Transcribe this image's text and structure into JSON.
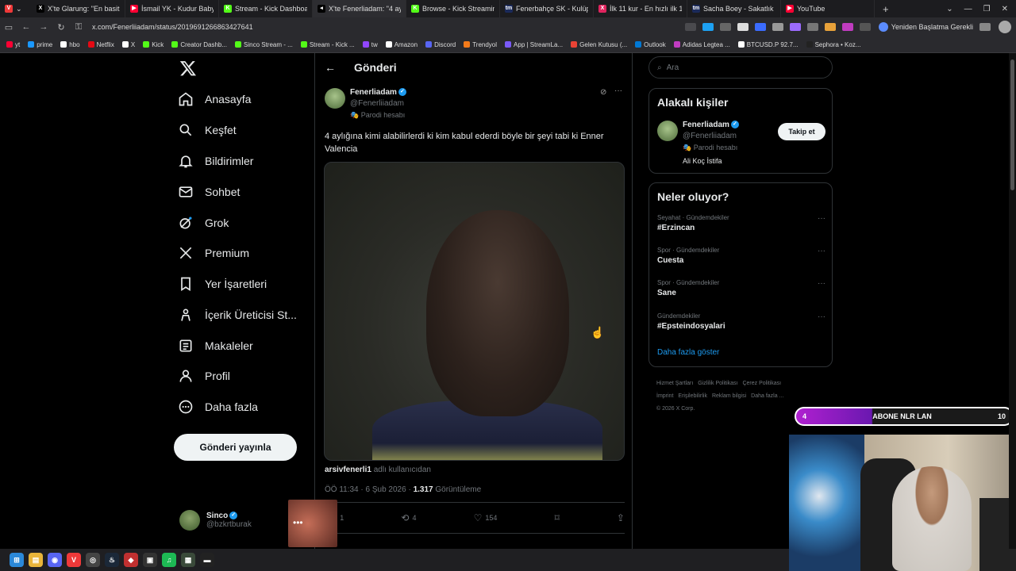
{
  "browser": {
    "tabs": [
      {
        "label": "X'te Glarung: \"En basitinde",
        "fav_color": "#000000",
        "fav_glyph": "X"
      },
      {
        "label": "İsmail YK - Kudur Baby ( Ug",
        "fav_color": "#ff0033",
        "fav_glyph": "▶"
      },
      {
        "label": "Stream - Kick Dashboard",
        "fav_color": "#53fc18",
        "fav_glyph": "K"
      },
      {
        "label": "X'te Fenerliadam: \"4 aylığın",
        "fav_color": "#000000",
        "fav_glyph": "◂"
      },
      {
        "label": "Browse - Kick Streaming",
        "fav_color": "#53fc18",
        "fav_glyph": "K"
      },
      {
        "label": "Fenerbahçe SK - Kulüp pro",
        "fav_color": "#1b2a5a",
        "fav_glyph": "tm"
      },
      {
        "label": "İlk 11 kur - En hızlı ilk 11 ol",
        "fav_color": "#e0245e",
        "fav_glyph": "X"
      },
      {
        "label": "Sacha Boey - Sakatlık geçmi",
        "fav_color": "#1b2a5a",
        "fav_glyph": "tm"
      },
      {
        "label": "YouTube",
        "fav_color": "#ff0033",
        "fav_glyph": "▶"
      }
    ],
    "active_tab": 3,
    "url": "x.com/Fenerliiadam/status/2019691266863427641",
    "restart_label": "Yeniden Başlatma Gerekli",
    "bookmarks": [
      {
        "label": "yt",
        "color": "#ff0033"
      },
      {
        "label": "prime",
        "color": "#1a98ff"
      },
      {
        "label": "hbo",
        "color": "#ffffff"
      },
      {
        "label": "Netflix",
        "color": "#e50914"
      },
      {
        "label": "X",
        "color": "#ffffff"
      },
      {
        "label": "Kick",
        "color": "#53fc18"
      },
      {
        "label": "Creator Dashb...",
        "color": "#53fc18"
      },
      {
        "label": "Sinco Stream - ...",
        "color": "#53fc18"
      },
      {
        "label": "Stream - Kick ...",
        "color": "#53fc18"
      },
      {
        "label": "tw",
        "color": "#9146ff"
      },
      {
        "label": "Amazon",
        "color": "#ffffff"
      },
      {
        "label": "Discord",
        "color": "#5865f2"
      },
      {
        "label": "Trendyol",
        "color": "#f27a1a"
      },
      {
        "label": "App | StreamLa...",
        "color": "#7a5af8"
      },
      {
        "label": "Gelen Kutusu (...",
        "color": "#ea4335"
      },
      {
        "label": "Outlook",
        "color": "#0078d4"
      },
      {
        "label": "Adidas Legtea ...",
        "color": "#c03cc0"
      },
      {
        "label": "BTCUSD.P 92.7...",
        "color": "#ffffff"
      },
      {
        "label": "Sephora • Koz...",
        "color": "#222222"
      }
    ]
  },
  "nav": {
    "items": [
      {
        "label": "Anasayfa",
        "icon": "home-icon"
      },
      {
        "label": "Keşfet",
        "icon": "search-icon"
      },
      {
        "label": "Bildirimler",
        "icon": "bell-icon"
      },
      {
        "label": "Sohbet",
        "icon": "mail-icon"
      },
      {
        "label": "Grok",
        "icon": "grok-icon"
      },
      {
        "label": "Premium",
        "icon": "x-icon"
      },
      {
        "label": "Yer İşaretleri",
        "icon": "bookmark-icon"
      },
      {
        "label": "İçerik Üreticisi St...",
        "icon": "creator-icon"
      },
      {
        "label": "Makaleler",
        "icon": "article-icon"
      },
      {
        "label": "Profil",
        "icon": "person-icon"
      },
      {
        "label": "Daha fazla",
        "icon": "more-circle-icon"
      }
    ],
    "post_button": "Gönderi yayınla",
    "account": {
      "name": "Sinco",
      "handle": "@bzkrtburak"
    }
  },
  "post": {
    "header_title": "Gönderi",
    "author_name": "Fenerliadam",
    "author_handle": "@Fenerliiadam",
    "parody_label": "Parodi hesabı",
    "text": "4 aylığına kimi alabilirlerdi ki kim kabul ederdi böyle bir şeyi tabi ki Enner Valencia",
    "credit_user": "arsivfenerli1",
    "credit_suffix": "adlı kullanıcıdan",
    "timestamp": "ÖÖ 11:34 · 6 Şub 2026 · ",
    "views": "1.317",
    "views_label": "Görüntüleme",
    "replies": "1",
    "reposts": "4",
    "likes": "154"
  },
  "sidebar": {
    "search_placeholder": "Ara",
    "people_title": "Alakalı kişiler",
    "person": {
      "name": "Fenerliadam",
      "handle": "@Fenerliiadam",
      "parody": "Parodi hesabı",
      "bio": "Ali Koç İstifa",
      "follow_label": "Takip et"
    },
    "trends_title": "Neler oluyor?",
    "trends": [
      {
        "category": "Seyahat · Gündemdekiler",
        "name": "#Erzincan"
      },
      {
        "category": "Spor · Gündemdekiler",
        "name": "Cuesta"
      },
      {
        "category": "Spor · Gündemdekiler",
        "name": "Sane"
      },
      {
        "category": "Gündemdekiler",
        "name": "#Epsteindosyalari"
      }
    ],
    "show_more": "Daha fazla göster",
    "footer": [
      "Hizmet Şartları",
      "Gizlilik Politikası",
      "Çerez Politikası",
      "İmprint",
      "Erişilebilirlik",
      "Reklam bilgisi",
      "Daha fazla ...",
      "© 2026 X Corp."
    ]
  },
  "overlay": {
    "sub_start": "4",
    "sub_label": "ABONE NLR LAN",
    "sub_goal": "10",
    "sub_progress_fraction": 0.35
  },
  "colors": {
    "accent": "#1d9bf0",
    "kick": "#53fc18",
    "overlay": "#b020d0"
  }
}
